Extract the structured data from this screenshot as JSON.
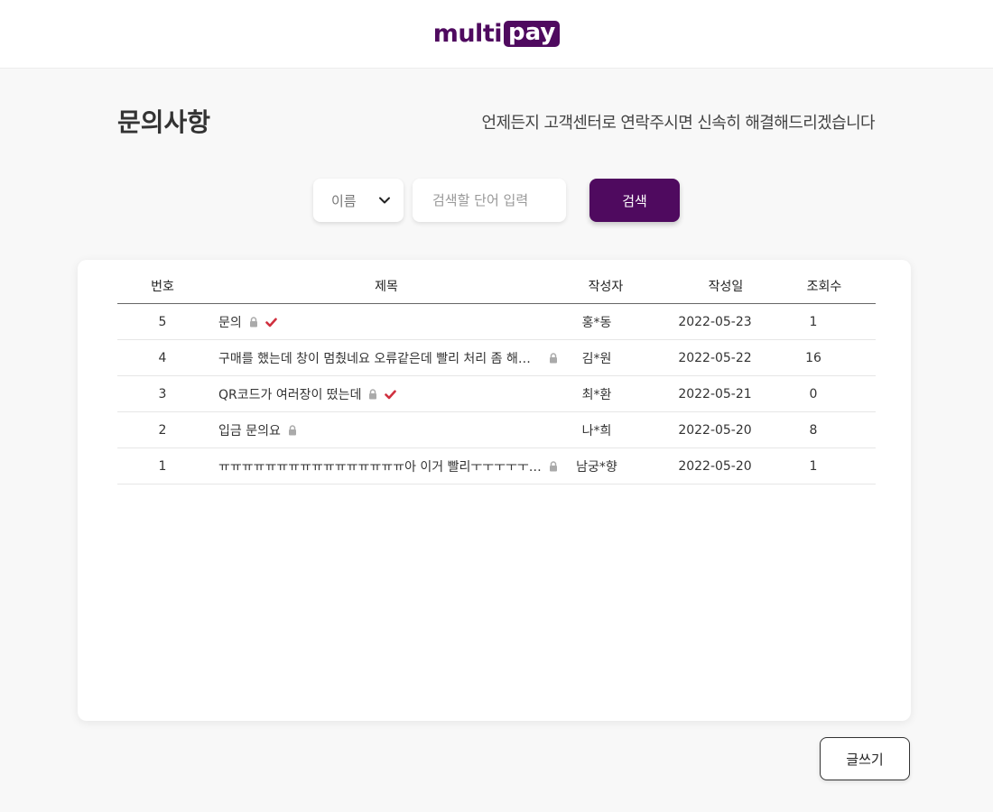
{
  "header": {
    "logo_left": "multi",
    "logo_right": "pay"
  },
  "page": {
    "title": "문의사항",
    "subtitle": "언제든지 고객센터로 연락주시면 신속히 해결해드리겠습니다"
  },
  "search": {
    "filter_value": "이름",
    "placeholder": "검색할 단어 입력",
    "button_label": "검색"
  },
  "table": {
    "columns": [
      "번호",
      "제목",
      "작성자",
      "작성일",
      "조회수"
    ],
    "rows": [
      {
        "num": "5",
        "title": "문의",
        "author": "홍*동",
        "date": "2022-05-23",
        "views": "1",
        "locked": true,
        "answered": true
      },
      {
        "num": "4",
        "title": "구매를 했는데 창이 멈췄네요 오류같은데 빨리 처리 좀 해주...",
        "author": "김*원",
        "date": "2022-05-22",
        "views": "16",
        "locked": true,
        "answered": false
      },
      {
        "num": "3",
        "title": "QR코드가 여러장이 떴는데",
        "author": "최*환",
        "date": "2022-05-21",
        "views": "0",
        "locked": true,
        "answered": true
      },
      {
        "num": "2",
        "title": "입금 문의요",
        "author": "나*희",
        "date": "2022-05-20",
        "views": "8",
        "locked": true,
        "answered": false
      },
      {
        "num": "1",
        "title": "ㅠㅠㅠㅠㅠㅠㅠㅠㅠㅠㅠㅠㅠㅠㅠㅠ아 이거 빨리ㅜㅜㅜㅜㅜㅜㅜ...",
        "author": "남궁*향",
        "date": "2022-05-20",
        "views": "1",
        "locked": true,
        "answered": false
      }
    ]
  },
  "write_button_label": "글쓰기",
  "colors": {
    "brand": "#4f0a5f",
    "check": "#d0303f",
    "lock": "#aaaaaa"
  }
}
